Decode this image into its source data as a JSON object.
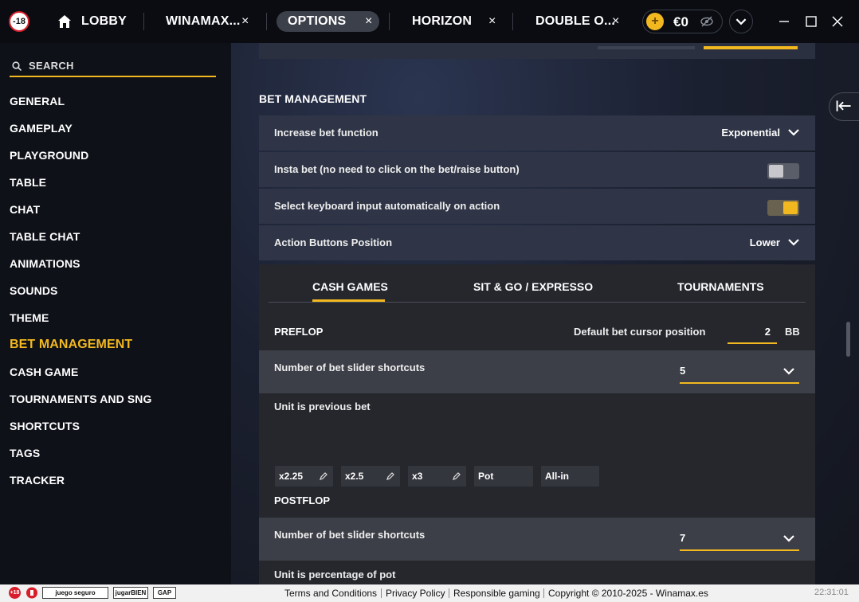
{
  "topbar": {
    "age_badge": "-18",
    "tabs": [
      {
        "label": "LOBBY",
        "icon": "home-icon"
      },
      {
        "label": "WINAMAX...",
        "close": "×"
      },
      {
        "label": "OPTIONS",
        "close": "×",
        "active": true
      },
      {
        "label": "HORIZON",
        "close": "×"
      },
      {
        "label": "DOUBLE O...",
        "close": "×"
      }
    ],
    "balance": {
      "coin_symbol": "+",
      "amount": "€0",
      "icon": "eye-slash-icon"
    },
    "window_controls": [
      "minimize-icon",
      "maximize-icon",
      "close-icon"
    ]
  },
  "sidebar": {
    "search_placeholder": "SEARCH",
    "items": [
      {
        "label": "GENERAL"
      },
      {
        "label": "GAMEPLAY"
      },
      {
        "label": "PLAYGROUND"
      },
      {
        "label": "TABLE"
      },
      {
        "label": "CHAT"
      },
      {
        "label": "TABLE CHAT"
      },
      {
        "label": "ANIMATIONS"
      },
      {
        "label": "SOUNDS"
      },
      {
        "label": "THEME"
      },
      {
        "label": "BET MANAGEMENT",
        "active": true
      },
      {
        "label": "CASH GAME"
      },
      {
        "label": "TOURNAMENTS AND SNG"
      },
      {
        "label": "SHORTCUTS"
      },
      {
        "label": "TAGS"
      },
      {
        "label": "TRACKER"
      }
    ]
  },
  "main": {
    "section_title": "BET MANAGEMENT",
    "rows": [
      {
        "label": "Increase bet function",
        "value": "Exponential"
      },
      {
        "label": "Insta bet (no need to click on the bet/raise button)",
        "toggle": "off"
      },
      {
        "label": "Select keyboard input automatically on action",
        "toggle": "on"
      },
      {
        "label": "Action Buttons Position",
        "value": "Lower"
      }
    ],
    "subtabs": [
      {
        "label": "CASH GAMES",
        "active": true
      },
      {
        "label": "SIT & GO / EXPRESSO"
      },
      {
        "label": "TOURNAMENTS"
      }
    ],
    "preflop": {
      "label": "PREFLOP",
      "cursor_label": "Default bet cursor position",
      "cursor_value": "2",
      "cursor_unit": "BB",
      "shortcuts_label": "Number of bet slider shortcuts",
      "shortcuts_value": "5",
      "unit_label": "Unit is previous bet",
      "chips": [
        "x2.25",
        "x2.5",
        "x3",
        "Pot",
        "All-in"
      ]
    },
    "postflop": {
      "label": "POSTFLOP",
      "shortcuts_label": "Number of bet slider shortcuts",
      "shortcuts_value": "7",
      "unit_label": "Unit is percentage of pot"
    }
  },
  "footer": {
    "badges": [
      "+18",
      "juego seguro",
      "jugarBIEN",
      "GAP"
    ],
    "links": [
      "Terms and Conditions",
      "Privacy Policy",
      "Responsible gaming"
    ],
    "copyright": "Copyright © 2010-2025 - Winamax.es",
    "clock": "22:31:01"
  },
  "colors": {
    "accent": "#f2b81f",
    "background": "#0e1118",
    "row_bg": "#2f3546"
  }
}
